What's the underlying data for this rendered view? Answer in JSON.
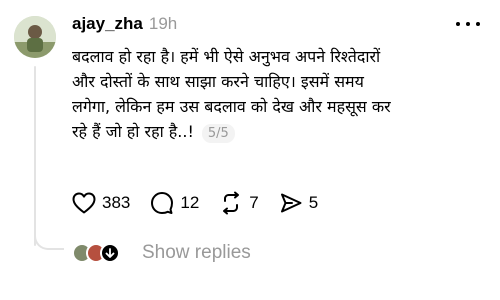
{
  "post": {
    "username": "ajay_zha",
    "timestamp": "19h",
    "body_lines": [
      "बदलाव हो रहा है। हमें भी ऐसे अनुभव अपने रिश्तेदारों",
      "और दोस्तों के साथ साझा करने चाहिए। इसमें समय",
      "लगेगा, लेकिन हम उस बदलाव को देख और महसूस कर",
      "रहे हैं जो हो रहा है..!"
    ],
    "page_indicator": "5/5"
  },
  "actions": {
    "likes": "383",
    "comments": "12",
    "reposts": "7",
    "shares": "5"
  },
  "replies": {
    "label": "Show replies"
  },
  "icons": {
    "more": "more-icon",
    "like": "heart-icon",
    "comment": "comment-icon",
    "repost": "repost-icon",
    "share": "share-icon"
  }
}
